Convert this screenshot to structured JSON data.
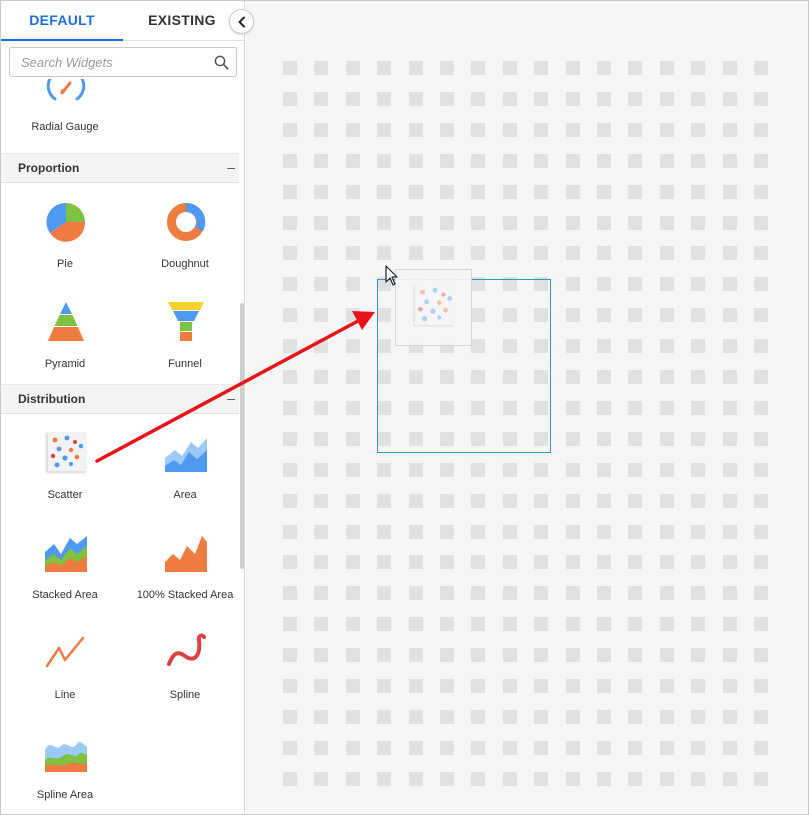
{
  "tabs": {
    "default_label": "DEFAULT",
    "existing_label": "EXISTING"
  },
  "search": {
    "placeholder": "Search Widgets"
  },
  "widgets": {
    "radial_gauge": "Radial Gauge",
    "proportion": {
      "title": "Proportion",
      "toggle": "–",
      "items": [
        "Pie",
        "Doughnut",
        "Pyramid",
        "Funnel"
      ]
    },
    "distribution": {
      "title": "Distribution",
      "toggle": "–",
      "items": [
        "Scatter",
        "Area",
        "Stacked Area",
        "100% Stacked Area",
        "Line",
        "Spline",
        "Spline Area"
      ]
    }
  },
  "colors": {
    "accent": "#1e6fd9",
    "selection": "#2f93c8",
    "arrow": "#e8141b",
    "chart_blue": "#4f9af0",
    "chart_orange": "#ee7b3f",
    "chart_green": "#7fc243",
    "chart_yellow": "#f5d12a",
    "chart_red": "#d94242"
  },
  "icons": {
    "search": "search-icon",
    "collapse": "chevron-left-icon",
    "drag_cursor": "pointer-cursor-icon",
    "annotation": "red-arrow-annotation"
  }
}
